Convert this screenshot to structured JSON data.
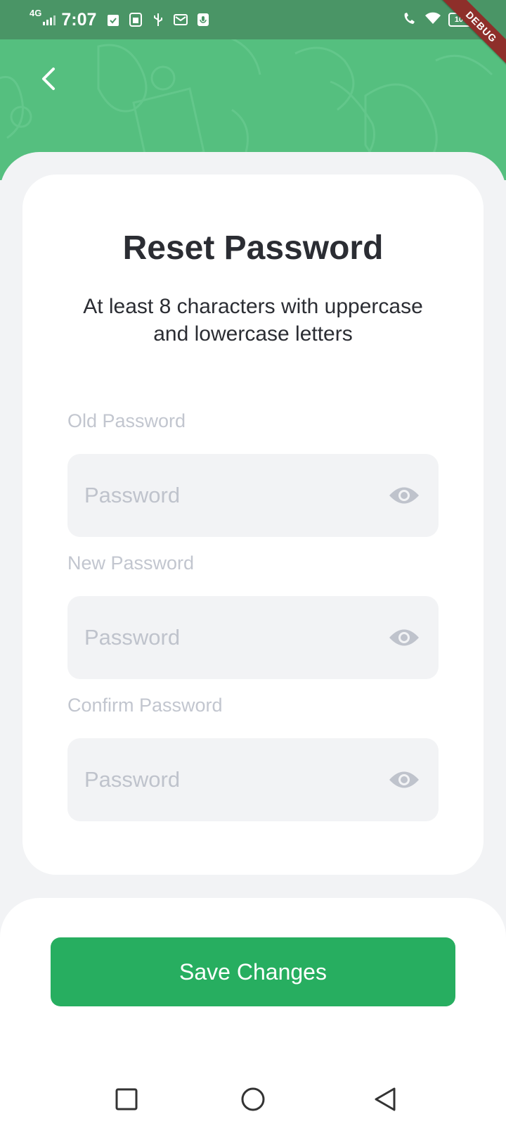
{
  "status_bar": {
    "network": "4G",
    "time": "7:07",
    "battery": "100"
  },
  "debug_banner": "DEBUG",
  "page": {
    "title": "Reset Password",
    "subtitle": "At least 8 characters with uppercase and lowercase letters"
  },
  "fields": [
    {
      "label": "Old Password",
      "placeholder": "Password",
      "value": ""
    },
    {
      "label": "New Password",
      "placeholder": "Password",
      "value": ""
    },
    {
      "label": "Confirm Password",
      "placeholder": "Password",
      "value": ""
    }
  ],
  "actions": {
    "save_label": "Save Changes"
  },
  "colors": {
    "header_green": "#55BF7F",
    "status_bar": "#4A9566",
    "primary_button": "#27AE60",
    "field_background": "#F2F3F5",
    "placeholder_text": "#BFC3CC",
    "debug_ribbon": "#8E2F2A"
  },
  "icons": {
    "back": "chevron-left-icon",
    "eye": "eye-icon",
    "nav_recents": "square-icon",
    "nav_home": "circle-icon",
    "nav_back": "triangle-left-icon"
  }
}
